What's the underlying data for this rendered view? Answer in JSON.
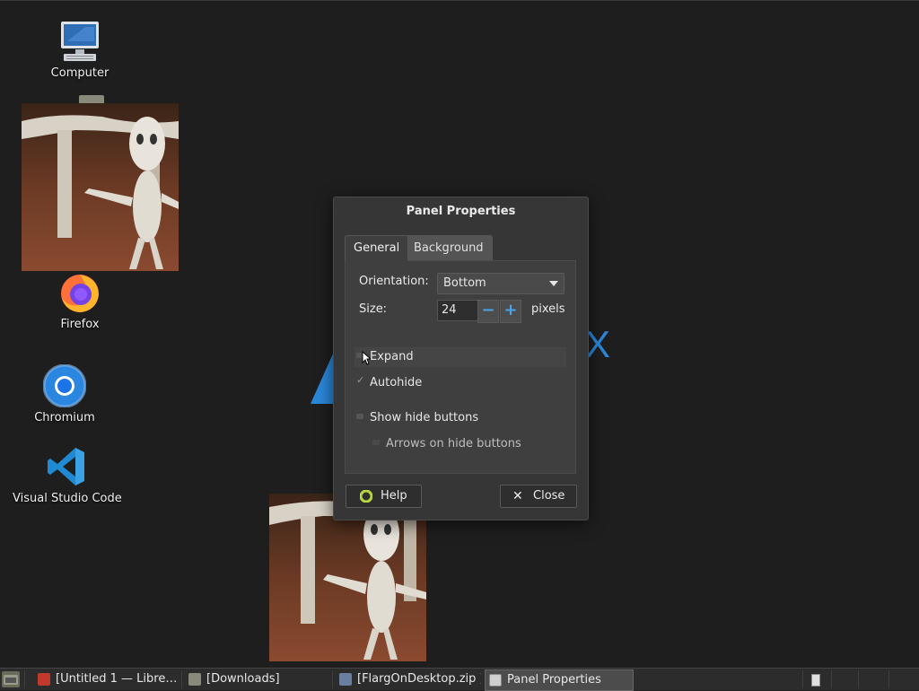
{
  "desktop": {
    "icons": [
      {
        "label": "Computer",
        "icon": "computer-icon"
      },
      {
        "label": "Firefox",
        "icon": "firefox-icon"
      },
      {
        "label": "Chromium",
        "icon": "chromium-icon"
      },
      {
        "label": "Visual Studio Code",
        "icon": "vscode-icon"
      }
    ]
  },
  "dialog": {
    "title": "Panel Properties",
    "tabs": [
      {
        "label": "General",
        "active": true
      },
      {
        "label": "Background",
        "active": false
      }
    ],
    "orientation": {
      "label": "Orientation:",
      "value": "Bottom"
    },
    "size": {
      "label": "Size:",
      "value": "24",
      "unit": "pixels",
      "decrement": "−",
      "increment": "+"
    },
    "checks": [
      {
        "label": "Expand",
        "checked": false
      },
      {
        "label": "Autohide",
        "checked": true
      },
      {
        "label": "Show hide buttons",
        "checked": false
      },
      {
        "label": "Arrows on hide buttons",
        "checked": false,
        "disabled": true
      }
    ],
    "help_label": "Help",
    "close_label": "Close"
  },
  "taskbar": {
    "tasks": [
      {
        "label": "[Untitled 1 — Libre…",
        "icon": "libreoffice-icon",
        "color": "#c0392b"
      },
      {
        "label": "[Downloads]",
        "icon": "folder-icon",
        "color": "#8a8a7a"
      },
      {
        "label": "[FlargOnDesktop.zip ]",
        "icon": "archive-icon",
        "color": "#6a7fa0"
      },
      {
        "label": "Panel Properties",
        "icon": "window-icon",
        "color": "#cfcfcf",
        "active": true
      }
    ]
  },
  "colors": {
    "accent": "#2b87d9",
    "background": "#1e1e1e",
    "dialog": "#363636"
  }
}
